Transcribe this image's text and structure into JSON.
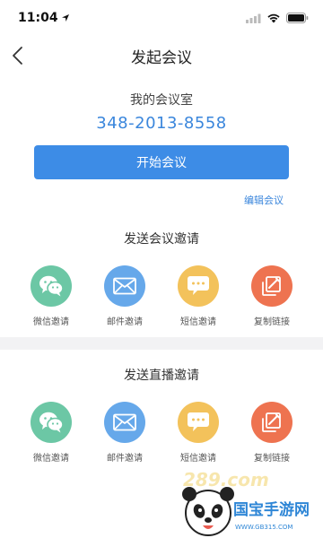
{
  "status": {
    "time": "11:04"
  },
  "nav": {
    "title": "发起会议"
  },
  "meeting": {
    "room_label": "我的会议室",
    "room_number": "348-2013-8558",
    "start_label": "开始会议",
    "edit_label": "编辑会议"
  },
  "invite_meeting": {
    "title": "发送会议邀请",
    "items": [
      {
        "label": "微信邀请",
        "icon": "wechat-icon",
        "color": "#6cc7a5"
      },
      {
        "label": "邮件邀请",
        "icon": "mail-icon",
        "color": "#66a8ea"
      },
      {
        "label": "短信邀请",
        "icon": "sms-icon",
        "color": "#f3c25b"
      },
      {
        "label": "复制链接",
        "icon": "copy-link-icon",
        "color": "#ee7350"
      }
    ]
  },
  "invite_live": {
    "title": "发送直播邀请",
    "items": [
      {
        "label": "微信邀请",
        "icon": "wechat-icon",
        "color": "#6cc7a5"
      },
      {
        "label": "邮件邀请",
        "icon": "mail-icon",
        "color": "#66a8ea"
      },
      {
        "label": "短信邀请",
        "icon": "sms-icon",
        "color": "#f3c25b"
      },
      {
        "label": "复制链接",
        "icon": "copy-link-icon",
        "color": "#ee7350"
      }
    ]
  },
  "watermark": {
    "logo_text": "国宝手游网",
    "url": "WWW.GB315.COM",
    "brand_overlay": "289.com"
  }
}
